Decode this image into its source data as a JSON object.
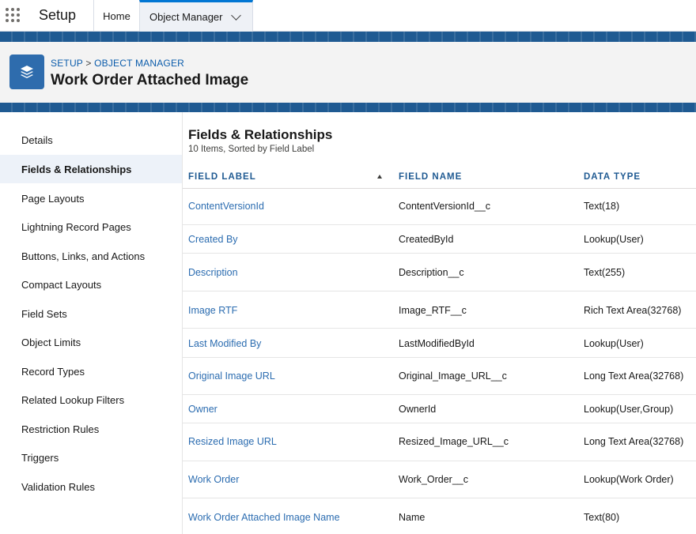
{
  "topbar": {
    "app_name": "Setup",
    "tabs": [
      {
        "label": "Home"
      },
      {
        "label": "Object Manager"
      }
    ]
  },
  "header": {
    "breadcrumb": [
      "SETUP",
      "OBJECT MANAGER"
    ],
    "breadcrumb_separator": ">",
    "title": "Work Order Attached Image",
    "icon": "stacked-layers-icon"
  },
  "sidebar": {
    "items": [
      {
        "label": "Details"
      },
      {
        "label": "Fields & Relationships",
        "active": true
      },
      {
        "label": "Page Layouts"
      },
      {
        "label": "Lightning Record Pages"
      },
      {
        "label": "Buttons, Links, and Actions"
      },
      {
        "label": "Compact Layouts"
      },
      {
        "label": "Field Sets"
      },
      {
        "label": "Object Limits"
      },
      {
        "label": "Record Types"
      },
      {
        "label": "Related Lookup Filters"
      },
      {
        "label": "Restriction Rules"
      },
      {
        "label": "Triggers"
      },
      {
        "label": "Validation Rules"
      }
    ]
  },
  "main": {
    "title": "Fields & Relationships",
    "subtitle": "10 Items, Sorted by Field Label",
    "columns": [
      "FIELD LABEL",
      "FIELD NAME",
      "DATA TYPE"
    ],
    "sort_column": "FIELD LABEL",
    "sort_direction": "ascending",
    "rows": [
      {
        "label": "ContentVersionId",
        "name": "ContentVersionId__c",
        "type": "Text(18)"
      },
      {
        "label": "Created By",
        "name": "CreatedById",
        "type": "Lookup(User)"
      },
      {
        "label": "Description",
        "name": "Description__c",
        "type": "Text(255)"
      },
      {
        "label": "Image RTF",
        "name": "Image_RTF__c",
        "type": "Rich Text Area(32768)"
      },
      {
        "label": "Last Modified By",
        "name": "LastModifiedById",
        "type": "Lookup(User)"
      },
      {
        "label": "Original Image URL",
        "name": "Original_Image_URL__c",
        "type": "Long Text Area(32768)"
      },
      {
        "label": "Owner",
        "name": "OwnerId",
        "type": "Lookup(User,Group)"
      },
      {
        "label": "Resized Image URL",
        "name": "Resized_Image_URL__c",
        "type": "Long Text Area(32768)"
      },
      {
        "label": "Work Order",
        "name": "Work_Order__c",
        "type": "Lookup(Work Order)"
      },
      {
        "label": "Work Order Attached Image Name",
        "name": "Name",
        "type": "Text(80)"
      }
    ]
  },
  "colors": {
    "brand_band": "#1f5a92",
    "link": "#2b6cb0",
    "column_header": "#1f5a92",
    "active_nav_bg": "#edf2f9",
    "object_icon_bg": "#2e6cad"
  }
}
